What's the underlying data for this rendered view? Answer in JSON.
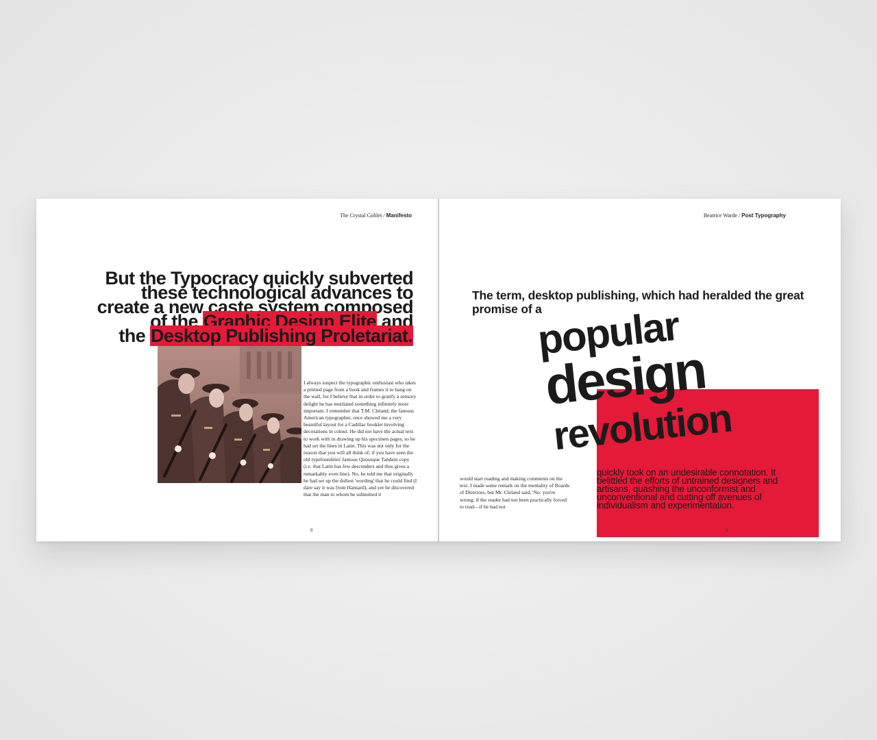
{
  "left_page": {
    "running_head_prefix": "The Crystal Goblet / ",
    "running_head_bold": "Manifesto",
    "headline_lines": [
      "But the Typocracy quickly subverted",
      "these technological advances to",
      "create a new caste system composed"
    ],
    "headline_line4_pre": "of the ",
    "headline_line4_red": "Graphic Design Elite",
    "headline_line4_post": " and",
    "headline_line5_pre": "the ",
    "headline_line5_red": "Desktop Publishing Proletariat.",
    "body_text": "I always suspect the typographic enthusiast who takes a printed page from a book and frames it to hang on the wall, for I believe that in order to gratify a sensory delight he has mutilated something infinitely more important. I remember that T.M. Cleland, the famous American typographer, once showed me a very beautiful layout for a Cadillac booklet involving decorations in colour. He did not have the actual text to work with in drawing up his specimen pages, so he had set the lines in Latin. This was not only for the reason that you will all think of; if you have seen the old typefoundries' famous Quousque Tandem copy (i.e. that Latin has few descenders and thus gives a remarkably even line). No, he told me that originally he had set up the dullest 'wording' that he could find (I dare say it was from Hansard), and yet he discovered that the man to whom he submitted it",
    "folio": "8"
  },
  "right_page": {
    "running_head_prefix": "Beatrice Warde / ",
    "running_head_bold": "Post Typography",
    "lead_text": "The term, desktop publishing, which had heralded the great promise of a",
    "big_word_1": "popular",
    "big_word_2": "design",
    "big_word_3": "revolution",
    "body_text": "would start reading and making comments on the text. I made some remark on the mentality of Boards of Directors, but Mr. Cleland said, 'No: you're wrong; if the reader had not been practically forced to read—if he had not",
    "red_text": "quickly took on an undesirable connotation. It belittled the efforts of untrained designers and artisans, quashing the unconformist and unconventional and cutting off avenues of individualism and experimentation.",
    "folio": "9"
  },
  "colors": {
    "accent_red": "#e41a38",
    "ink": "#1b1b1b",
    "photo_tint": "#8d6760"
  }
}
